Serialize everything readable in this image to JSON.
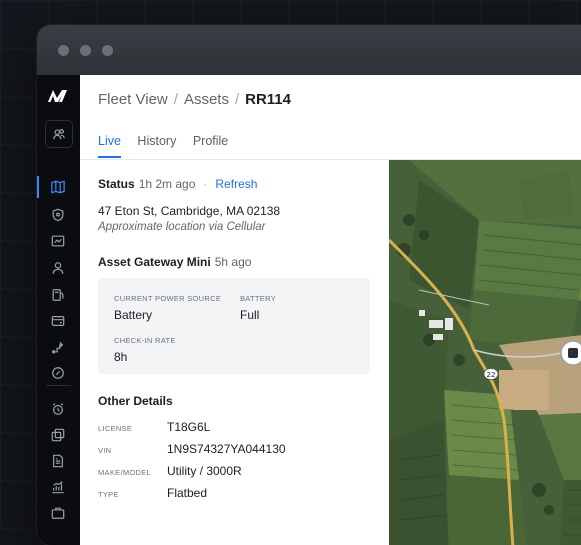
{
  "breadcrumb": {
    "items": [
      "Fleet View",
      "Assets"
    ],
    "current": "RR114"
  },
  "tabs": [
    {
      "label": "Live",
      "active": true
    },
    {
      "label": "History",
      "active": false
    },
    {
      "label": "Profile",
      "active": false
    }
  ],
  "status": {
    "label": "Status",
    "ago": "1h 2m ago",
    "refresh": "Refresh",
    "address": "47 Eton St, Cambridge, MA 02138",
    "approx": "Approximate location via Cellular"
  },
  "gateway": {
    "name": "Asset Gateway Mini",
    "ago": "5h ago",
    "power_label": "CURRENT POWER SOURCE",
    "power_value": "Battery",
    "battery_label": "BATTERY",
    "battery_value": "Full",
    "checkin_label": "CHECK-IN RATE",
    "checkin_value": "8h"
  },
  "details": {
    "title": "Other Details",
    "rows": [
      {
        "label": "LICENSE",
        "value": "T18G6L"
      },
      {
        "label": "VIN",
        "value": "1N9S74327YA044130"
      },
      {
        "label": "MAKE/MODEL",
        "value": "Utility / 3000R"
      },
      {
        "label": "TYPE",
        "value": "Flatbed"
      }
    ]
  },
  "map": {
    "road_label": "22"
  },
  "sidebar": {
    "icons": [
      "users-icon",
      "map-icon",
      "shield-icon",
      "chart-icon",
      "person-icon",
      "fuel-icon",
      "card-icon",
      "route-icon",
      "tag-icon",
      "alarm-icon",
      "copy-icon",
      "document-icon",
      "trend-icon",
      "briefcase-icon"
    ]
  },
  "colors": {
    "accent": "#1f6fe5",
    "sidebar": "#0b0c0f",
    "titlebar": "#34373d"
  }
}
